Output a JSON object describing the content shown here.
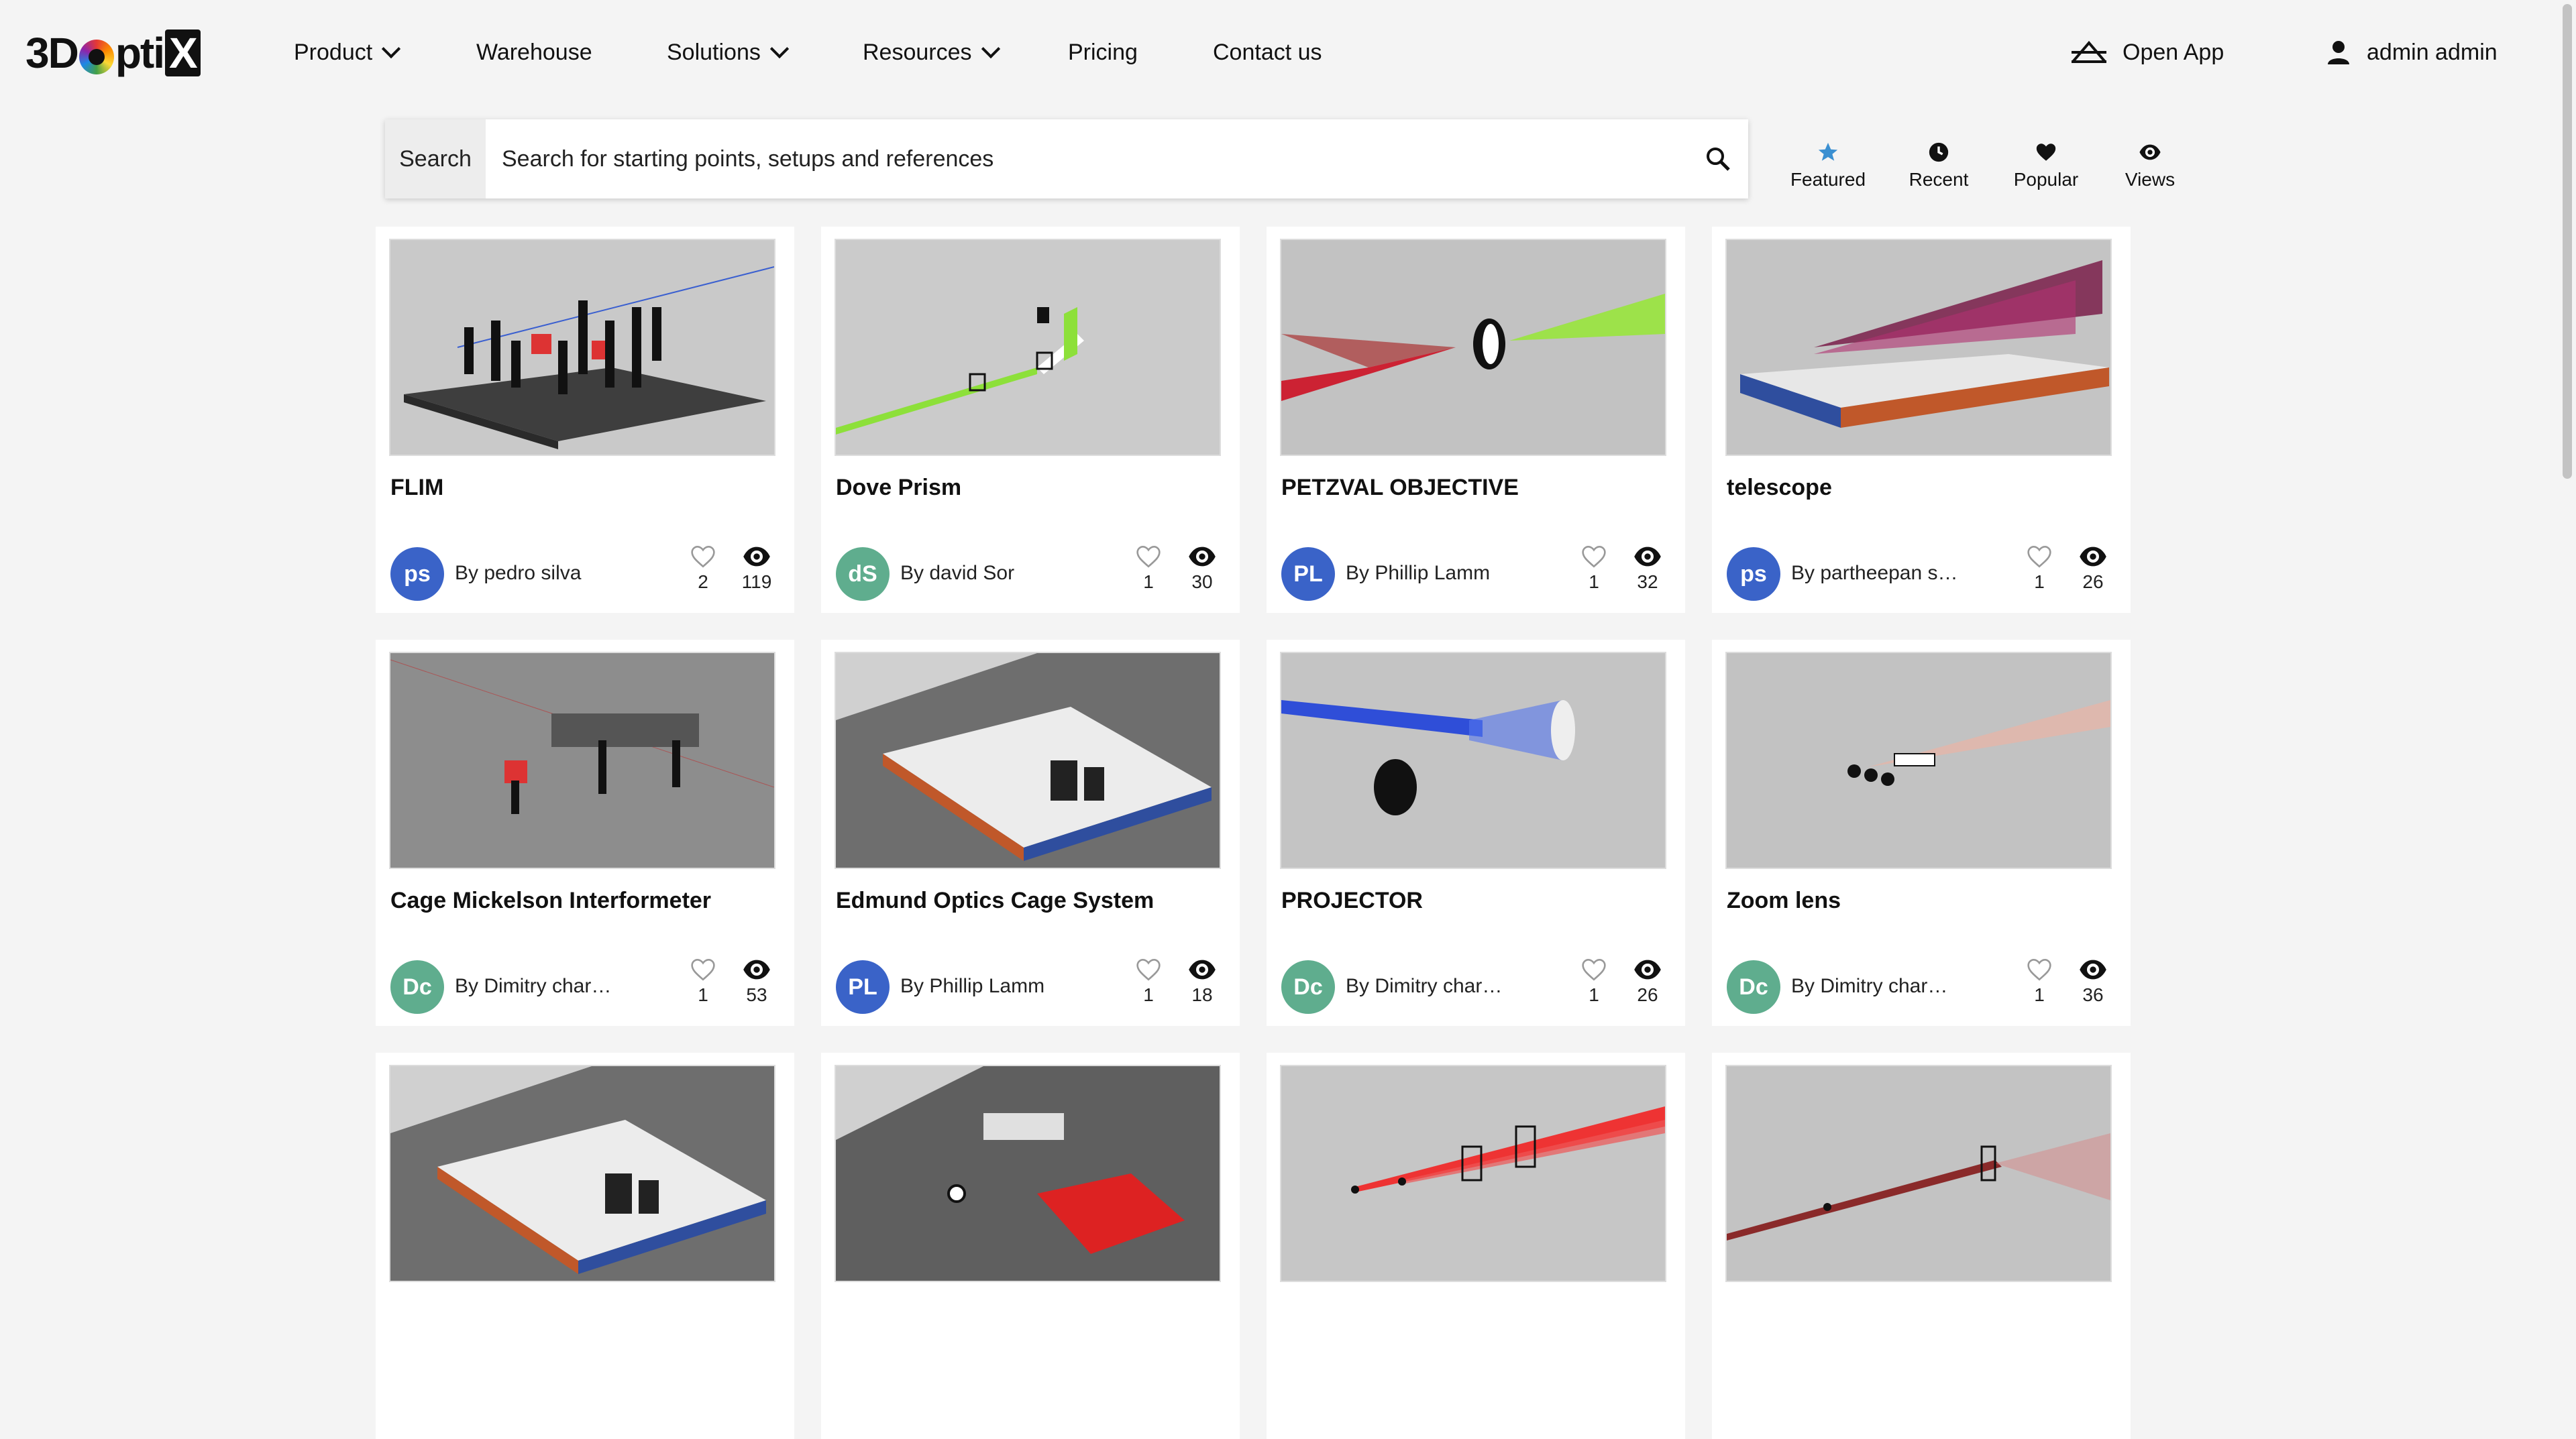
{
  "brand": {
    "logo_left": "3D",
    "logo_mid": "pti",
    "logo_right": "X"
  },
  "nav": {
    "product": "Product",
    "warehouse": "Warehouse",
    "solutions": "Solutions",
    "resources": "Resources",
    "pricing": "Pricing",
    "contact": "Contact us"
  },
  "header": {
    "open_app": "Open App",
    "user_name": "admin admin"
  },
  "search": {
    "label": "Search",
    "placeholder": "Search for starting points, setups and references",
    "value": ""
  },
  "filters": {
    "featured": "Featured",
    "recent": "Recent",
    "popular": "Popular",
    "views": "Views",
    "active_color": "#3a8fd1"
  },
  "avatar_colors": {
    "blue": "#3a63c8",
    "green": "#5fad8e"
  },
  "cards": [
    {
      "title": "FLIM",
      "initials": "ps",
      "author": "By pedro silva",
      "likes": "2",
      "views": "119",
      "avatar": "blue",
      "icon": "optical-table-setup"
    },
    {
      "title": "Dove Prism",
      "initials": "dS",
      "author": "By david Sor",
      "likes": "1",
      "views": "30",
      "avatar": "green",
      "icon": "prism-beam"
    },
    {
      "title": "PETZVAL OBJECTIVE",
      "initials": "PL",
      "author": "By Phillip Lamm",
      "likes": "1",
      "views": "32",
      "avatar": "blue",
      "icon": "lens-rays"
    },
    {
      "title": "telescope",
      "initials": "ps",
      "author": "By partheepan senth...",
      "likes": "1",
      "views": "26",
      "avatar": "blue",
      "icon": "table-ray-fan"
    },
    {
      "title": "Cage Mickelson Interformeter",
      "initials": "Dc",
      "author": "By Dimitry charnov",
      "likes": "1",
      "views": "53",
      "avatar": "green",
      "icon": "cage-system"
    },
    {
      "title": "Edmund Optics Cage System",
      "initials": "PL",
      "author": "By Phillip Lamm",
      "likes": "1",
      "views": "18",
      "avatar": "blue",
      "icon": "optical-table"
    },
    {
      "title": "PROJECTOR",
      "initials": "Dc",
      "author": "By Dimitry charnov",
      "likes": "1",
      "views": "26",
      "avatar": "green",
      "icon": "projector-rays"
    },
    {
      "title": "Zoom lens",
      "initials": "Dc",
      "author": "By Dimitry charnov",
      "likes": "1",
      "views": "36",
      "avatar": "green",
      "icon": "zoom-lens"
    },
    {
      "title": "",
      "initials": "",
      "author": "",
      "likes": "",
      "views": "",
      "avatar": "blue",
      "icon": "optical-table"
    },
    {
      "title": "",
      "initials": "",
      "author": "",
      "likes": "",
      "views": "",
      "avatar": "blue",
      "icon": "laser-table"
    },
    {
      "title": "",
      "initials": "",
      "author": "",
      "likes": "",
      "views": "",
      "avatar": "blue",
      "icon": "red-beams"
    },
    {
      "title": "",
      "initials": "",
      "author": "",
      "likes": "",
      "views": "",
      "avatar": "blue",
      "icon": "red-beam-fan"
    }
  ]
}
